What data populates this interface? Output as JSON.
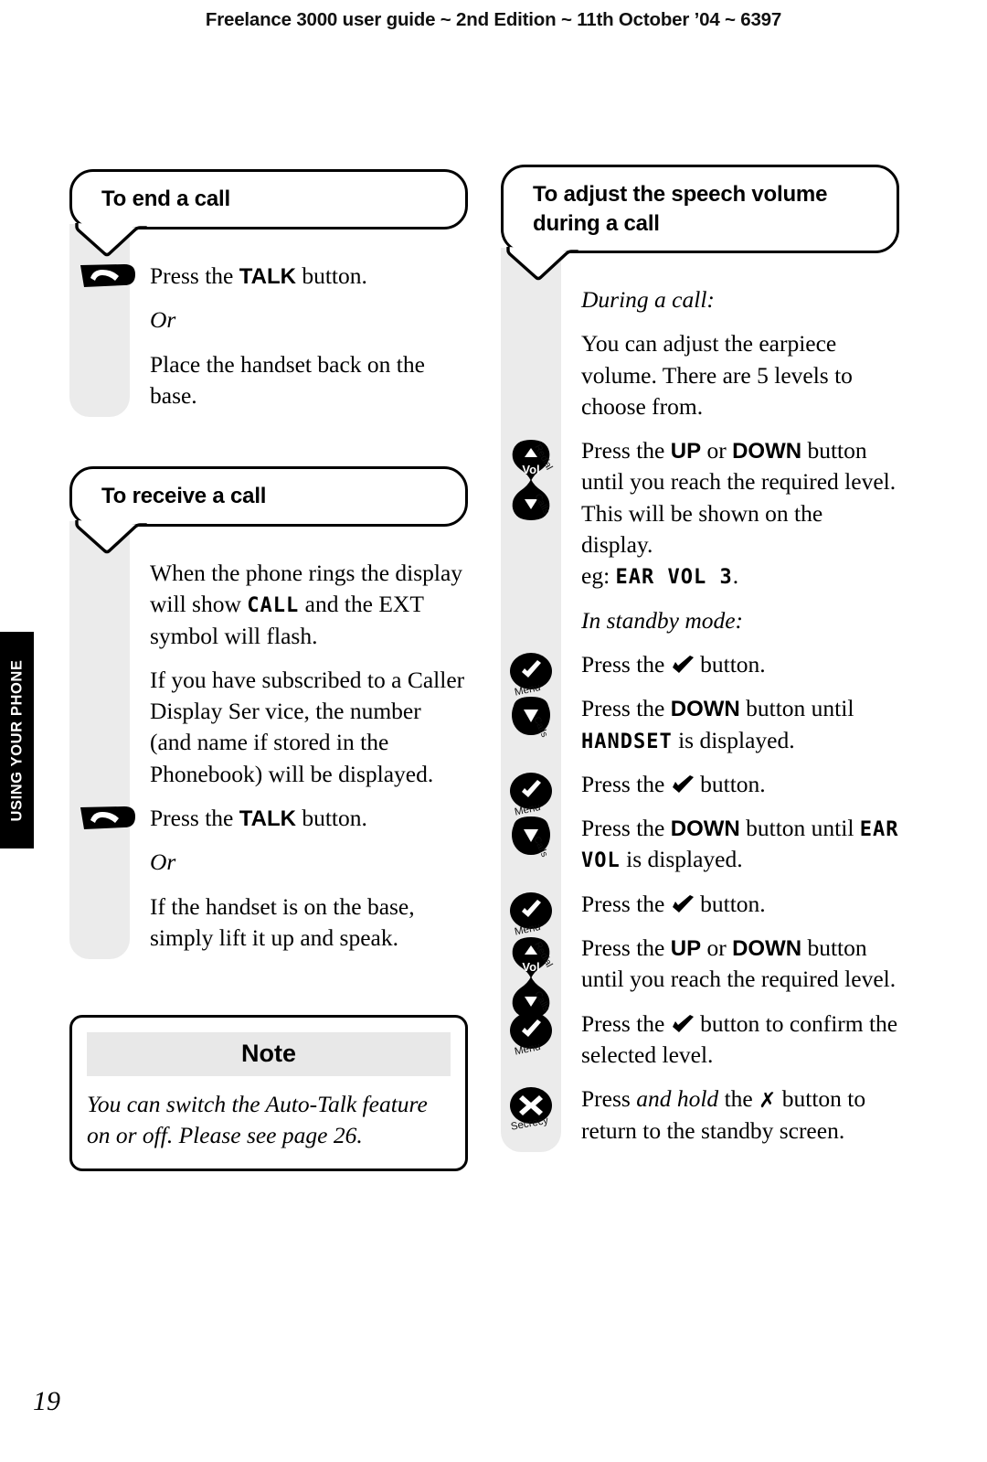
{
  "header": {
    "running_head": "Freelance 3000 user guide ~ 2nd Edition ~ 11th October ’04 ~ 6397"
  },
  "side_tab": {
    "label": "USING YOUR PHONE"
  },
  "footer": {
    "page_number": "19"
  },
  "icon_labels": {
    "menu": "Menu",
    "vol": "Vol",
    "redial": "Redial",
    "calls": "Calls",
    "secrecy": "Secrecy"
  },
  "left_column": {
    "sections": [
      {
        "heading": "To end a call",
        "rows": [
          {
            "icon": "talk-key-icon",
            "text_html": "Press the <span class=\"b\">TALK</span> button."
          },
          {
            "icon": null,
            "text_html": "<span class=\"i\">Or</span>"
          },
          {
            "icon": null,
            "text_html": "Place the handset back on the base."
          }
        ]
      },
      {
        "heading": "To receive a call",
        "rows": [
          {
            "icon": null,
            "text_html": "When the phone rings the display will show <span class=\"lcd\">CALL</span> and the EXT symbol will flash."
          },
          {
            "icon": null,
            "text_html": "If you have subscribed to a Caller Display Ser vice, the number (and name if stored in the Phonebook) will be displayed."
          },
          {
            "icon": "talk-key-icon",
            "text_html": "Press the <span class=\"b\">TALK</span> button."
          },
          {
            "icon": null,
            "text_html": "<span class=\"i\">Or</span>"
          },
          {
            "icon": null,
            "text_html": "If the handset is on the base, simply lift it up and speak."
          }
        ]
      }
    ],
    "note": {
      "title": "Note",
      "body": "You can switch the Auto-Talk feature on or off. Please see page 26."
    }
  },
  "right_column": {
    "sections": [
      {
        "heading": "To adjust the speech volume during a call",
        "rows": [
          {
            "icon": null,
            "text_html": "<span class=\"i\">During a call:</span>"
          },
          {
            "icon": null,
            "text_html": "You can adjust the earpiece volume. There are 5 levels to choose from."
          },
          {
            "icon": "vol-rocker-icon",
            "text_html": "Press the <span class=\"b\">UP</span> or <span class=\"b\">DOWN</span> button until you reach the required level. This will be shown on the display.<br>eg: <span class=\"lcd\">EAR VOL 3</span>."
          },
          {
            "icon": null,
            "text_html": "<span class=\"i\">In standby mode:</span>"
          },
          {
            "icon": "menu-key-icon",
            "text_html": "Press the @CHECK@ button."
          },
          {
            "icon": "down-calls-key-icon",
            "text_html": "Press the <span class=\"b\">DOWN</span> button until <span class=\"lcd\">HANDSET</span> is displayed."
          },
          {
            "icon": "menu-key-icon",
            "text_html": "Press the @CHECK@ button."
          },
          {
            "icon": "down-calls-key-icon",
            "text_html": "Press the <span class=\"b\">DOWN</span> button until <span class=\"lcd\">EAR VOL</span> is displayed."
          },
          {
            "icon": "menu-key-icon",
            "text_html": "Press the @CHECK@ button."
          },
          {
            "icon": "vol-rocker-icon",
            "text_html": "Press the <span class=\"b\">UP</span> or <span class=\"b\">DOWN</span> button until you reach the required level."
          },
          {
            "icon": "menu-key-icon",
            "text_html": "Press the @CHECK@ button to confirm the selected level."
          },
          {
            "icon": "secrecy-key-icon",
            "text_html": "Press <span class=\"i\">and hold</span> the @X@ button to return to the standby screen."
          }
        ]
      }
    ]
  }
}
